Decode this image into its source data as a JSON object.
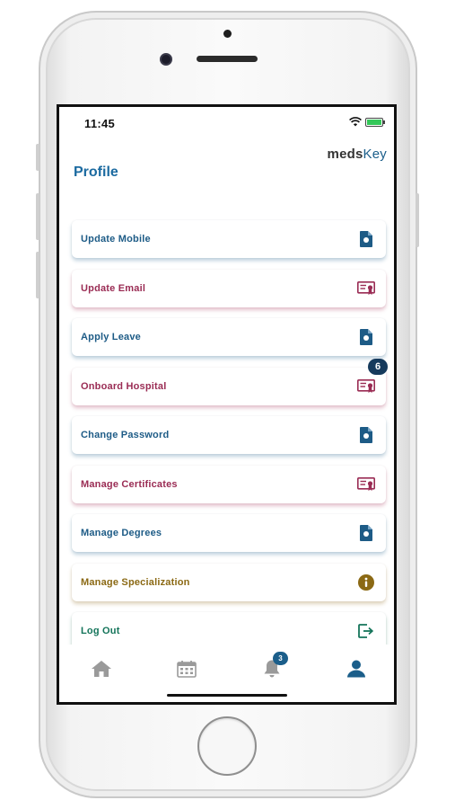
{
  "status_bar": {
    "time": "11:45"
  },
  "header": {
    "brand_prefix": "meds",
    "brand_suffix": "Key",
    "title": "Profile"
  },
  "menu": {
    "items": [
      {
        "label": "Update Mobile",
        "tone": "blue",
        "icon": "file-badge-icon"
      },
      {
        "label": "Update Email",
        "tone": "pink",
        "icon": "certificate-icon"
      },
      {
        "label": "Apply Leave",
        "tone": "blue",
        "icon": "file-badge-icon"
      },
      {
        "label": "Onboard Hospital",
        "tone": "pink",
        "icon": "certificate-icon",
        "badge": "6"
      },
      {
        "label": "Change Password",
        "tone": "blue",
        "icon": "file-badge-icon"
      },
      {
        "label": "Manage Certificates",
        "tone": "pink",
        "icon": "certificate-icon"
      },
      {
        "label": "Manage Degrees",
        "tone": "blue",
        "icon": "file-badge-icon"
      },
      {
        "label": "Manage Specialization",
        "tone": "gold",
        "icon": "info-circle-icon"
      },
      {
        "label": "Log Out",
        "tone": "green",
        "icon": "logout-icon"
      }
    ]
  },
  "tab_bar": {
    "tabs": [
      {
        "icon": "home-icon",
        "active": false
      },
      {
        "icon": "calendar-icon",
        "active": false
      },
      {
        "icon": "bell-icon",
        "active": false,
        "badge": "3"
      },
      {
        "icon": "user-icon",
        "active": true
      }
    ]
  },
  "colors": {
    "blue": "#1d5b86",
    "pink": "#9a2c54",
    "gold": "#8b6914",
    "green": "#14745a",
    "tab_inactive": "#9a9a9a",
    "tab_active": "#1b5e8a",
    "badge": "#163a5c"
  }
}
